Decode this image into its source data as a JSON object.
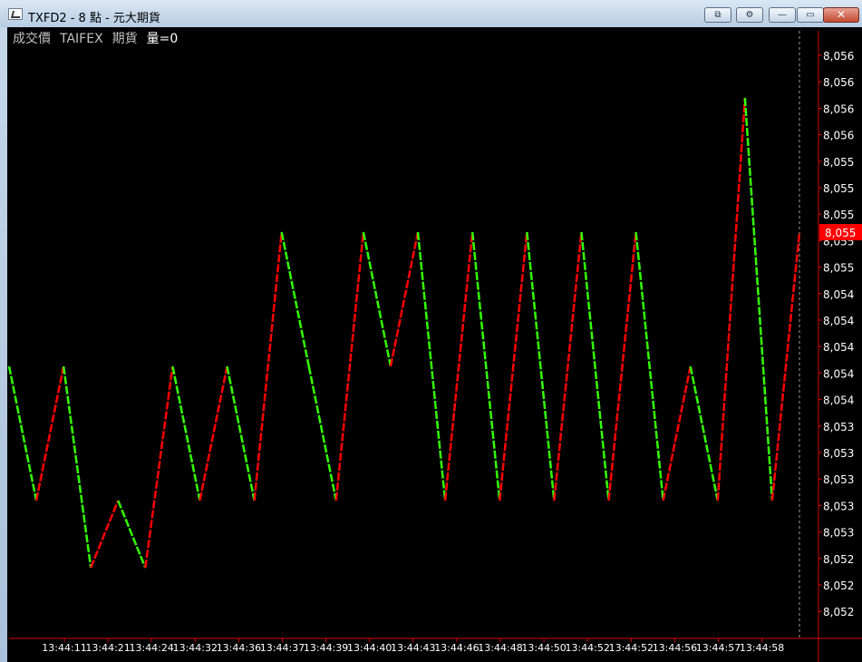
{
  "window": {
    "title": "TXFD2 - 8 點 - 元大期貨",
    "buttons": {
      "restore_label": "⧉",
      "settings_label": "⚙",
      "minimize_label": "—",
      "maximize_label": "▭",
      "close_label": "✕"
    }
  },
  "legend": {
    "series_label": "成交價",
    "exchange_label": "TAIFEX",
    "product_label": "期貨",
    "volume_label": "量=0"
  },
  "colors": {
    "up": "#ff0000",
    "down": "#32ff00",
    "background": "#000000",
    "axis": "#d40000",
    "price_tag": "#ff0000"
  },
  "chart_data": {
    "type": "line",
    "y_tick_labels": [
      "8,056",
      "8,056",
      "8,056",
      "8,056",
      "8,055",
      "8,055",
      "8,055",
      "8,055",
      "8,055",
      "8,054",
      "8,054",
      "8,054",
      "8,054",
      "8,054",
      "8,053",
      "8,053",
      "8,053",
      "8,053",
      "8,053",
      "8,052",
      "8,052",
      "8,052"
    ],
    "x_labels": [
      "13:44:11",
      "13:44:21",
      "13:44:24",
      "13:44:32",
      "13:44:36",
      "13:44:37",
      "13:44:39",
      "13:44:40",
      "13:44:43",
      "13:44:46",
      "13:44:48",
      "13:44:50",
      "13:44:52",
      "13:44:52",
      "13:44:56",
      "13:44:57",
      "13:44:58"
    ],
    "current_price": "8,055",
    "price_points": [
      8054,
      8053,
      8054,
      8052.5,
      8053,
      8052.5,
      8054,
      8053,
      8054,
      8053,
      8055,
      8054,
      8053,
      8055,
      8054,
      8055,
      8053,
      8055,
      8053,
      8055,
      8053,
      8055,
      8053,
      8055,
      8053,
      8054,
      8053,
      8056,
      8053,
      8055
    ],
    "ylim": [
      8052,
      8056.5
    ],
    "grid": false
  }
}
